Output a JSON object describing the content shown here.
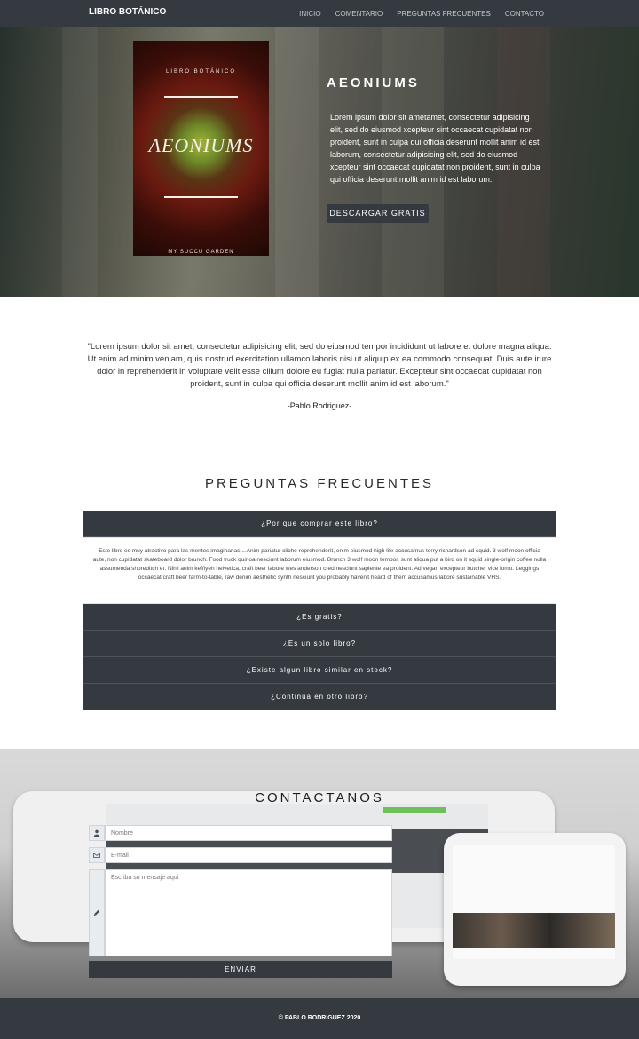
{
  "navbar": {
    "brand": "LIBRO BOTÁNICO",
    "links": [
      "INICIO",
      "COMENTARIO",
      "PREGUNTAS FRECUENTES",
      "CONTACTO"
    ]
  },
  "hero": {
    "cover": {
      "publisher": "LIBRO BOTÁNICO",
      "title": "AEONIUMS",
      "subtitle": "MY SUCCU GARDEN"
    },
    "title": "AEONIUMS",
    "text": "Lorem ipsum dolor sit ametamet, consectetur adipisicing elit, sed do eiusmod xcepteur sint occaecat cupidatat non proident, sunt in culpa qui officia deserunt mollit anim id est laborum, consectetur adipisicing elit, sed do eiusmod xcepteur sint occaecat cupidatat non proident, sunt in culpa qui officia deserunt mollit anim id est laborum.",
    "button": "DESCARGAR GRATIS"
  },
  "testimonial": {
    "quote": "\"Lorem ipsum dolor sit amet, consectetur adipisicing elit, sed do eiusmod tempor incididunt ut labore et dolore magna aliqua. Ut enim ad minim veniam, quis nostrud exercitation ullamco laboris nisi ut aliquip ex ea commodo consequat. Duis aute irure dolor in reprehenderit in voluptate velit esse cillum dolore eu fugiat nulla pariatur. Excepteur sint occaecat cupidatat non proident, sunt in culpa qui officia deserunt mollit anim id est laborum.\"",
    "author": "-Pablo Rodriguez-"
  },
  "faq": {
    "title": "PREGUNTAS FRECUENTES",
    "items": [
      {
        "question": "¿Por que comprar este libro?",
        "answer": "Este libro es muy atractivo para las mentes imaginarias....Anim pariatur cliche reprehenderit, enim eiusmod high life accusamus terry richardson ad squid. 3 wolf moon officia aute, non cupidatat skateboard dolor brunch. Food truck quinoa nesciunt laborum eiusmod. Brunch 3 wolf moon tempor, sunt aliqua put a bird on it squid single-origin coffee nulla assumenda shoreditch et. Nihil anim keffiyeh helvetica, craft beer labore wes anderson cred nesciunt sapiente ea proident. Ad vegan excepteur butcher vice lomo. Leggings occaecat craft beer farm-to-table, raw denim aesthetic synth nesciunt you probably haven't heard of them accusamus labore sustainable VHS."
      },
      {
        "question": "¿Es gratis?"
      },
      {
        "question": "¿Es un solo libro?"
      },
      {
        "question": "¿Existe algun libro similar en stock?"
      },
      {
        "question": "¿Continua en otro libro?"
      }
    ]
  },
  "contact": {
    "title": "CONTACTANOS",
    "name_placeholder": "Nombre",
    "email_placeholder": "E-mail",
    "message_placeholder": "Escriba su mensaje aqui",
    "button": "ENVIAR"
  },
  "footer": {
    "text": "© PABLO RODRIGUEZ 2020"
  },
  "colors": {
    "dark": "#343a40",
    "white": "#ffffff"
  }
}
